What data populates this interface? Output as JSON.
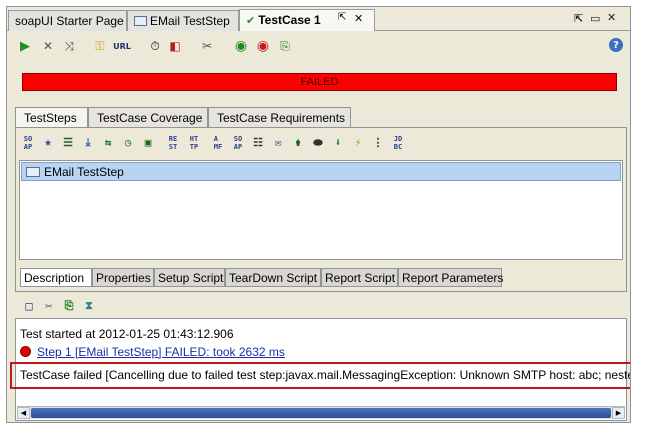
{
  "doc_tabs": [
    {
      "label": "soapUI Starter Page"
    },
    {
      "label": "EMail TestStep"
    },
    {
      "label": "TestCase 1"
    }
  ],
  "status": {
    "text": "FAILED",
    "color": "#ff0000"
  },
  "inner_tabs": [
    {
      "label": "TestSteps"
    },
    {
      "label": "TestCase Coverage"
    },
    {
      "label": "TestCase Requirements"
    }
  ],
  "step_toolbar_icons": [
    "SO AP",
    "star",
    "list",
    "down",
    "transfer",
    "timer",
    "play",
    "RE ST",
    "HT TP",
    "A MF",
    "SO AP",
    "props",
    "mail",
    "groovy",
    "assert",
    "cond",
    "goto",
    "run",
    "JD BC"
  ],
  "test_steps": [
    {
      "label": "EMail TestStep"
    }
  ],
  "sub_tabs": [
    {
      "label": "Description"
    },
    {
      "label": "Properties"
    },
    {
      "label": "Setup Script"
    },
    {
      "label": "TearDown Script"
    },
    {
      "label": "Report Script"
    },
    {
      "label": "Report Parameters"
    }
  ],
  "log": {
    "line1": "Test started at 2012-01-25 01:43:12.906",
    "line2": "Step 1 [EMail TestStep] FAILED: took 2632 ms",
    "line3": "TestCase failed [Cancelling due to failed test step:javax.mail.MessagingException: Unknown SMTP host: abc;  nested"
  },
  "toolbar_icons": [
    "run-icon",
    "cancel-icon",
    "loop-icon",
    "credentials-icon",
    "endpoint-icon",
    "timer-icon",
    "security-icon",
    "options-icon",
    "loadtest-icon",
    "securitytest-icon",
    "create-icon",
    "help-icon"
  ],
  "url_label": "URL",
  "tab_controls": {
    "pin": "⇱",
    "minimize": "▭",
    "close": "✕",
    "close2": "✕"
  }
}
